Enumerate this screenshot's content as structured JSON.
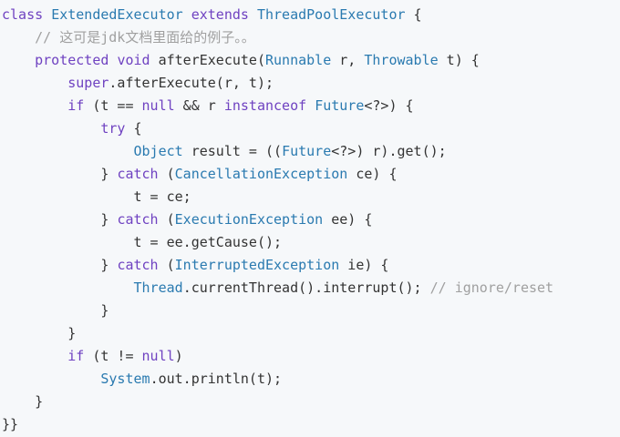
{
  "colors": {
    "background": "#f6f8fa",
    "keyword": "#6f42c1",
    "type": "#2a7ab0",
    "comment": "#a0a0a0",
    "plain": "#333333"
  },
  "code": {
    "lines": [
      [
        {
          "t": "kw",
          "v": "class "
        },
        {
          "t": "ty",
          "v": "ExtendedExecutor "
        },
        {
          "t": "kw",
          "v": "extends "
        },
        {
          "t": "ty",
          "v": "ThreadPoolExecutor"
        },
        {
          "t": "pl",
          "v": " {"
        }
      ],
      [
        {
          "t": "pl",
          "v": "    "
        },
        {
          "t": "cm",
          "v": "// 这可是jdk文档里面给的例子。。"
        }
      ],
      [
        {
          "t": "pl",
          "v": "    "
        },
        {
          "t": "kw",
          "v": "protected "
        },
        {
          "t": "kw",
          "v": "void "
        },
        {
          "t": "pl",
          "v": "afterExecute("
        },
        {
          "t": "ty",
          "v": "Runnable"
        },
        {
          "t": "pl",
          "v": " r, "
        },
        {
          "t": "ty",
          "v": "Throwable"
        },
        {
          "t": "pl",
          "v": " t) {"
        }
      ],
      [
        {
          "t": "pl",
          "v": "        "
        },
        {
          "t": "kw",
          "v": "super"
        },
        {
          "t": "pl",
          "v": ".afterExecute(r, t);"
        }
      ],
      [
        {
          "t": "pl",
          "v": "        "
        },
        {
          "t": "kw",
          "v": "if"
        },
        {
          "t": "pl",
          "v": " (t == "
        },
        {
          "t": "kw",
          "v": "null"
        },
        {
          "t": "pl",
          "v": " && r "
        },
        {
          "t": "kw",
          "v": "instanceof "
        },
        {
          "t": "ty",
          "v": "Future"
        },
        {
          "t": "pl",
          "v": "<?>) {"
        }
      ],
      [
        {
          "t": "pl",
          "v": "            "
        },
        {
          "t": "kw",
          "v": "try"
        },
        {
          "t": "pl",
          "v": " {"
        }
      ],
      [
        {
          "t": "pl",
          "v": "                "
        },
        {
          "t": "ty",
          "v": "Object"
        },
        {
          "t": "pl",
          "v": " result = (("
        },
        {
          "t": "ty",
          "v": "Future"
        },
        {
          "t": "pl",
          "v": "<?>) r).get();"
        }
      ],
      [
        {
          "t": "pl",
          "v": "            } "
        },
        {
          "t": "kw",
          "v": "catch"
        },
        {
          "t": "pl",
          "v": " ("
        },
        {
          "t": "ty",
          "v": "CancellationException"
        },
        {
          "t": "pl",
          "v": " ce) {"
        }
      ],
      [
        {
          "t": "pl",
          "v": "                t = ce;"
        }
      ],
      [
        {
          "t": "pl",
          "v": "            } "
        },
        {
          "t": "kw",
          "v": "catch"
        },
        {
          "t": "pl",
          "v": " ("
        },
        {
          "t": "ty",
          "v": "ExecutionException"
        },
        {
          "t": "pl",
          "v": " ee) {"
        }
      ],
      [
        {
          "t": "pl",
          "v": "                t = ee.getCause();"
        }
      ],
      [
        {
          "t": "pl",
          "v": "            } "
        },
        {
          "t": "kw",
          "v": "catch"
        },
        {
          "t": "pl",
          "v": " ("
        },
        {
          "t": "ty",
          "v": "InterruptedException"
        },
        {
          "t": "pl",
          "v": " ie) {"
        }
      ],
      [
        {
          "t": "pl",
          "v": "                "
        },
        {
          "t": "ty",
          "v": "Thread"
        },
        {
          "t": "pl",
          "v": ".currentThread().interrupt(); "
        },
        {
          "t": "cm",
          "v": "// ignore/reset"
        }
      ],
      [
        {
          "t": "pl",
          "v": "            }"
        }
      ],
      [
        {
          "t": "pl",
          "v": "        }"
        }
      ],
      [
        {
          "t": "pl",
          "v": "        "
        },
        {
          "t": "kw",
          "v": "if"
        },
        {
          "t": "pl",
          "v": " (t != "
        },
        {
          "t": "kw",
          "v": "null"
        },
        {
          "t": "pl",
          "v": ")"
        }
      ],
      [
        {
          "t": "pl",
          "v": "            "
        },
        {
          "t": "ty",
          "v": "System"
        },
        {
          "t": "pl",
          "v": ".out.println(t);"
        }
      ],
      [
        {
          "t": "pl",
          "v": "    }"
        }
      ],
      [
        {
          "t": "pl",
          "v": "}}"
        }
      ]
    ]
  }
}
